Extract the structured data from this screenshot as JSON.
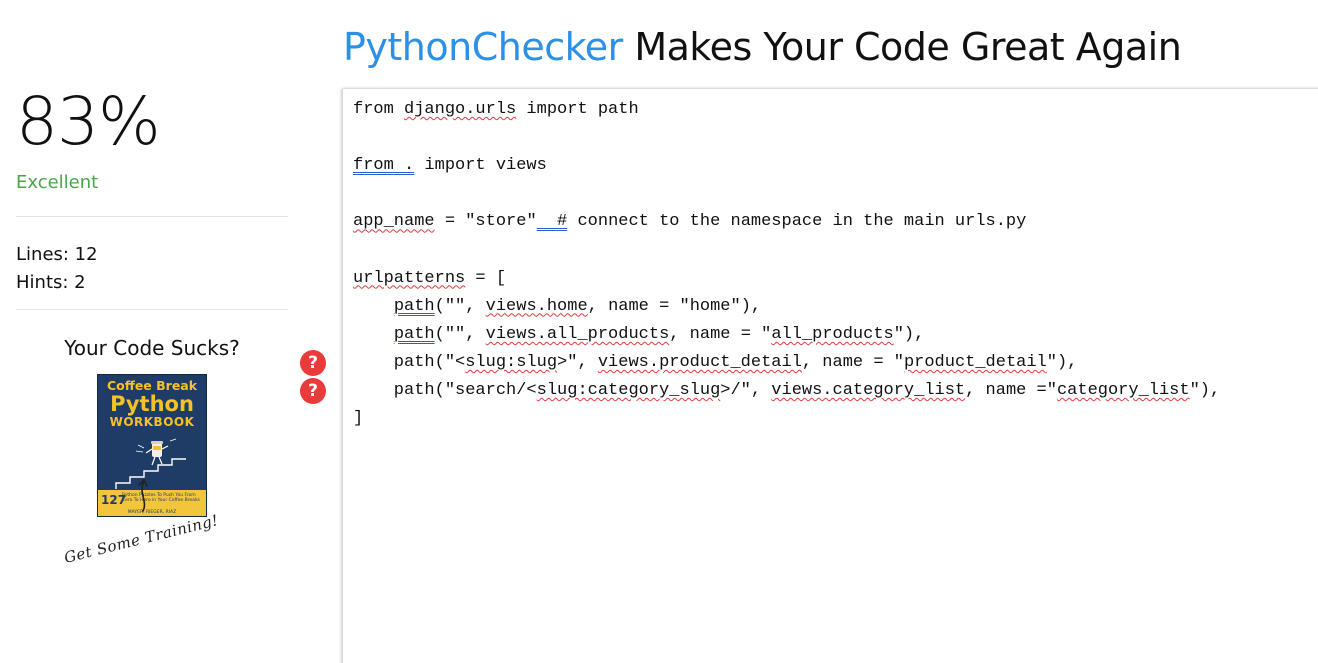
{
  "header": {
    "brand": "PythonChecker",
    "tagline": " Makes Your Code Great Again"
  },
  "sidebar": {
    "score": "83%",
    "rating": "Excellent",
    "lines_label": "Lines: 12",
    "hints_label": "Hints: 2",
    "promo_title": "Your Code Sucks?",
    "book": {
      "line1": "Coffee Break",
      "line2": "Python",
      "line3": "WORKBOOK",
      "number": "127",
      "subtitle": "Python Puzzles To Push You From Zero To Hero in Your Coffee Breaks",
      "authors": "MAYER, RIEGER, RIAZ"
    },
    "training": "Get Some Training!"
  },
  "hints": [
    "?",
    "?"
  ],
  "code_lines": [
    "from django.urls import path",
    "",
    "from . import views",
    "",
    "app_name = \"store\"  # connect to the namespace in the main urls.py",
    "",
    "urlpatterns = [",
    "    path(\"\", views.home, name = \"home\"),",
    "    path(\"\", views.all_products, name = \"all_products\"),",
    "    path(\"<slug:slug>\", views.product_detail, name = \"product_detail\"),",
    "    path(\"search/<slug:category_slug>/\", views.category_list, name =\"category_list\"),",
    "]"
  ],
  "colors": {
    "brand": "#2b90e6",
    "rating": "#4aa54a",
    "hint": "#ea3b3b",
    "squiggle": "#e23b3b",
    "hint_underline": "#2b5fd1"
  }
}
